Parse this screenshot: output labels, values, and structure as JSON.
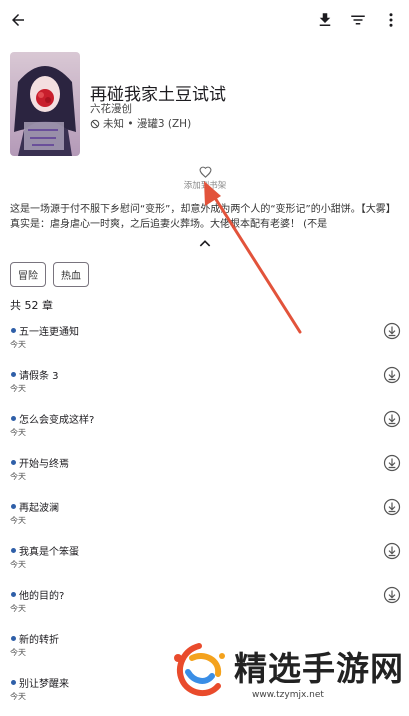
{
  "header": {
    "back_icon": "arrow-left-icon",
    "download_icon": "download-icon",
    "filter_icon": "filter-icon",
    "more_icon": "more-vertical-icon"
  },
  "manga": {
    "title": "再碰我家土豆试试",
    "author": "六花漫创",
    "status": "未知 • 漫罐3 (ZH)",
    "status_icon": "block-icon",
    "favorite_label": "添加到书架",
    "favorite_icon": "heart-outline-icon",
    "description": "这是一场源于付不服下乡慰问“变形”，却意外成为两个人的“变形记”的小甜饼。【大雾】真实是：虐身虐心一时爽，之后追妻火葬场。大佬根本配有老婆！ (不是",
    "collapse_icon": "chevron-up-icon",
    "tags": [
      "冒险",
      "热血"
    ]
  },
  "chapters": {
    "count_label": "共 52 章",
    "items": [
      {
        "name": "五一连更通知",
        "date": "今天"
      },
      {
        "name": "请假条 3",
        "date": "今天"
      },
      {
        "name": "怎么会变成这样?",
        "date": "今天"
      },
      {
        "name": "开始与终焉",
        "date": "今天"
      },
      {
        "name": "再起波澜",
        "date": "今天"
      },
      {
        "name": "我真是个笨蛋",
        "date": "今天"
      },
      {
        "name": "他的目的?",
        "date": "今天"
      },
      {
        "name": "新的转折",
        "date": "今天"
      },
      {
        "name": "别让梦醒来",
        "date": "今天"
      }
    ],
    "download_icon": "download-circle-icon"
  },
  "watermark": {
    "text": "精选手游网",
    "url": "www.tzymjx.net"
  },
  "colors": {
    "accent": "#2f5fa8",
    "arrow": "#e2533b"
  }
}
